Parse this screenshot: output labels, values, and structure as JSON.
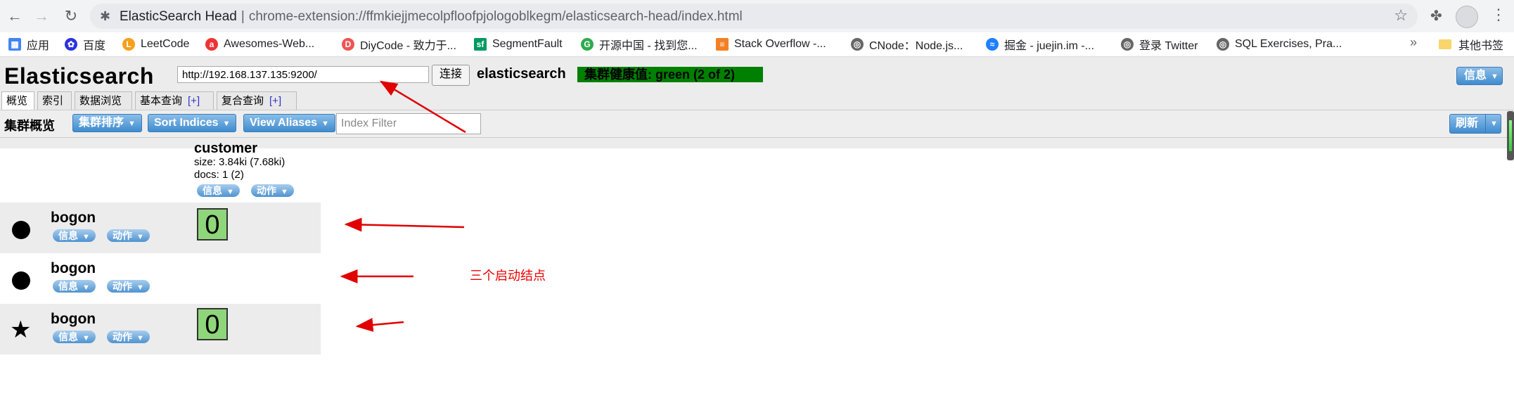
{
  "browser": {
    "tab_title": "ElasticSearch Head",
    "url": "chrome-extension://ffmkiejjmecolpfloofpjologoblkegm/elasticsearch-head/index.html",
    "icons": [
      "back-arrow-icon",
      "forward-arrow-icon",
      "reload-icon",
      "extension-icon",
      "star-icon",
      "puzzle-icon",
      "avatar-icon",
      "kebab-icon"
    ]
  },
  "bookmarks": [
    {
      "label": "应用",
      "icon": "apps-grid-icon",
      "color": "#4285f4"
    },
    {
      "label": "百度",
      "icon": "baidu-icon",
      "color": "#2932e1"
    },
    {
      "label": "LeetCode",
      "icon": "leetcode-icon",
      "color": "#f89f1b"
    },
    {
      "label": "Awesomes-Web...",
      "icon": "awesomes-icon",
      "color": "#e33"
    },
    {
      "label": "DiyCode - 致力于...",
      "icon": "diycode-icon",
      "color": "#e55"
    },
    {
      "label": "SegmentFault",
      "icon": "segmentfault-icon",
      "color": "#009a61"
    },
    {
      "label": "开源中国 - 找到您...",
      "icon": "oschina-icon",
      "color": "#2eab4f"
    },
    {
      "label": "Stack Overflow -...",
      "icon": "stackoverflow-icon",
      "color": "#f48024"
    },
    {
      "label": "CNode：Node.js...",
      "icon": "globe-icon",
      "color": "#666"
    },
    {
      "label": "掘金 - juejin.im -...",
      "icon": "juejin-icon",
      "color": "#1e80ff"
    },
    {
      "label": "登录 Twitter",
      "icon": "globe-icon",
      "color": "#666"
    },
    {
      "label": "SQL Exercises, Pra...",
      "icon": "globe-icon",
      "color": "#666"
    }
  ],
  "bookmarks_more": "»",
  "other_bookmarks": "其他书签",
  "es": {
    "title": "Elasticsearch",
    "connect_url": "http://192.168.137.135:9200/",
    "connect_label": "连接",
    "cluster_name": "elasticsearch",
    "health": "集群健康值: green (2 of 2)",
    "health_color": "#008000",
    "info_label": "信息",
    "tabs": [
      {
        "label": "概览",
        "plus": ""
      },
      {
        "label": "索引",
        "plus": ""
      },
      {
        "label": "数据浏览",
        "plus": ""
      },
      {
        "label": "基本查询",
        "plus": "[+]"
      },
      {
        "label": "复合查询",
        "plus": "[+]"
      }
    ],
    "overview_title": "集群概览",
    "sort_cluster": "集群排序",
    "sort_indices": "Sort Indices",
    "view_aliases": "View Aliases",
    "index_filter_placeholder": "Index Filter",
    "refresh": "刷新",
    "index": {
      "name": "customer",
      "size": "size: 3.84ki (7.68ki)",
      "docs": "docs: 1 (2)",
      "info": "信息",
      "action": "动作"
    },
    "nodes": [
      {
        "name": "bogon",
        "marker": "circle",
        "shard": "0",
        "info": "信息",
        "action": "动作"
      },
      {
        "name": "bogon",
        "marker": "circle",
        "shard": "",
        "info": "信息",
        "action": "动作"
      },
      {
        "name": "bogon",
        "marker": "star",
        "shard": "0",
        "info": "信息",
        "action": "动作"
      }
    ],
    "annotation": "三个启动结点",
    "annotation_color": "#e00000"
  }
}
